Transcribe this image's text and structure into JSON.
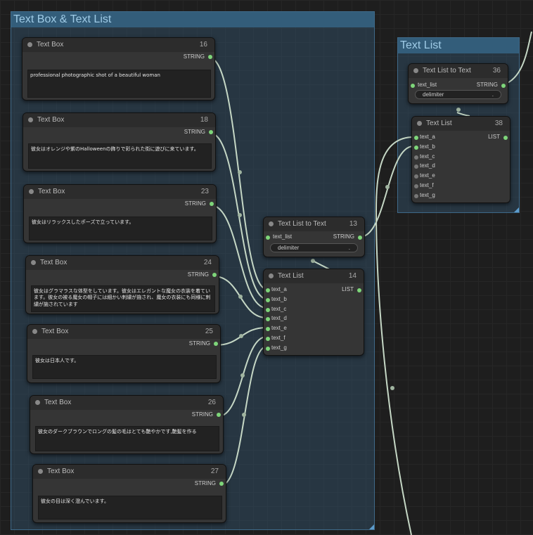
{
  "groups": {
    "left": {
      "title": "Text Box & Text List"
    },
    "right": {
      "title": "Text List"
    }
  },
  "colors": {
    "wire": "#c5d7c5",
    "socket_on": "#7ed67a",
    "group_header": "#335d7a"
  },
  "text_boxes": [
    {
      "title": "Text Box",
      "id": "16",
      "output": "STRING",
      "text": "professional photographic shot of a beautiful woman"
    },
    {
      "title": "Text Box",
      "id": "18",
      "output": "STRING",
      "text": "彼女はオレンジや紫のHalloweenの飾りで彩られた街に遊びに来ています。"
    },
    {
      "title": "Text Box",
      "id": "23",
      "output": "STRING",
      "text": "彼女はリラックスしたポーズで立っています。"
    },
    {
      "title": "Text Box",
      "id": "24",
      "output": "STRING",
      "text": "彼女はグラマラスな体型をしています。彼女はエレガントな魔女の衣装を着ています。彼女の被る魔女の帽子には細かい刺繍が施され、魔女の衣装にも同様に刺繍が施されています"
    },
    {
      "title": "Text Box",
      "id": "25",
      "output": "STRING",
      "text": "彼女は日本人です。"
    },
    {
      "title": "Text Box",
      "id": "26",
      "output": "STRING",
      "text": "彼女のダークブラウンでロングの髪の毛はとても艶やかです,艶髪を作る"
    },
    {
      "title": "Text Box",
      "id": "27",
      "output": "STRING",
      "text": "彼女の目は深く澄んでいます。"
    }
  ],
  "list_to_text_13": {
    "title": "Text List to Text",
    "id": "13",
    "input": "text_list",
    "output": "STRING",
    "widget_label": "delimiter",
    "widget_value": "."
  },
  "text_list_14": {
    "title": "Text List",
    "id": "14",
    "output": "LIST",
    "inputs": [
      "text_a",
      "text_b",
      "text_c",
      "text_d",
      "text_e",
      "text_f",
      "text_g"
    ]
  },
  "list_to_text_36": {
    "title": "Text List to Text",
    "id": "36",
    "input": "text_list",
    "output": "STRING",
    "widget_label": "delimiter",
    "widget_value": "."
  },
  "text_list_38": {
    "title": "Text List",
    "id": "38",
    "output": "LIST",
    "inputs": [
      "text_a",
      "text_b",
      "text_c",
      "text_d",
      "text_e",
      "text_f",
      "text_g"
    ]
  }
}
